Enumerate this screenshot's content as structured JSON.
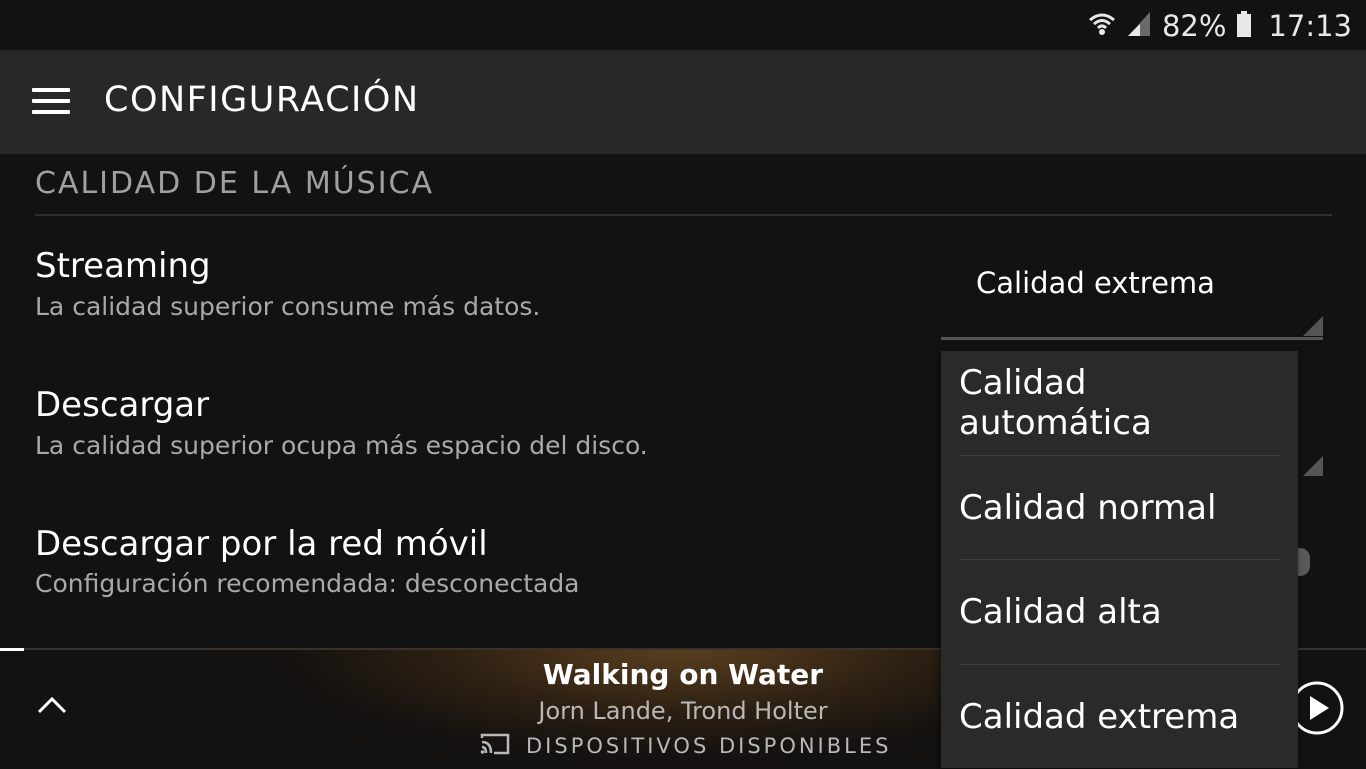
{
  "status_bar": {
    "battery_percent": "82%",
    "time": "17:13",
    "icons": [
      "wifi-icon",
      "signal-icon",
      "battery-icon"
    ]
  },
  "app_bar": {
    "title": "CONFIGURACIÓN",
    "menu_icon": "menu-icon"
  },
  "section": {
    "header": "CALIDAD DE LA MÚSICA",
    "settings": [
      {
        "title": "Streaming",
        "subtitle": "La calidad superior consume más datos.",
        "value": "Calidad extrema"
      },
      {
        "title": "Descargar",
        "subtitle": "La calidad superior ocupa más espacio del disco."
      },
      {
        "title": "Descargar por la red móvil",
        "subtitle": "Configuración recomendada: desconectada"
      }
    ]
  },
  "dropdown": {
    "options": [
      "Calidad automática",
      "Calidad normal",
      "Calidad alta",
      "Calidad extrema"
    ]
  },
  "now_playing": {
    "title": "Walking on Water",
    "artist": "Jorn Lande, Trond Holter",
    "devices_label": "DISPOSITIVOS DISPONIBLES"
  },
  "colors": {
    "background": "#121212",
    "app_bar": "#282828",
    "dropdown": "#2a2a2a"
  }
}
